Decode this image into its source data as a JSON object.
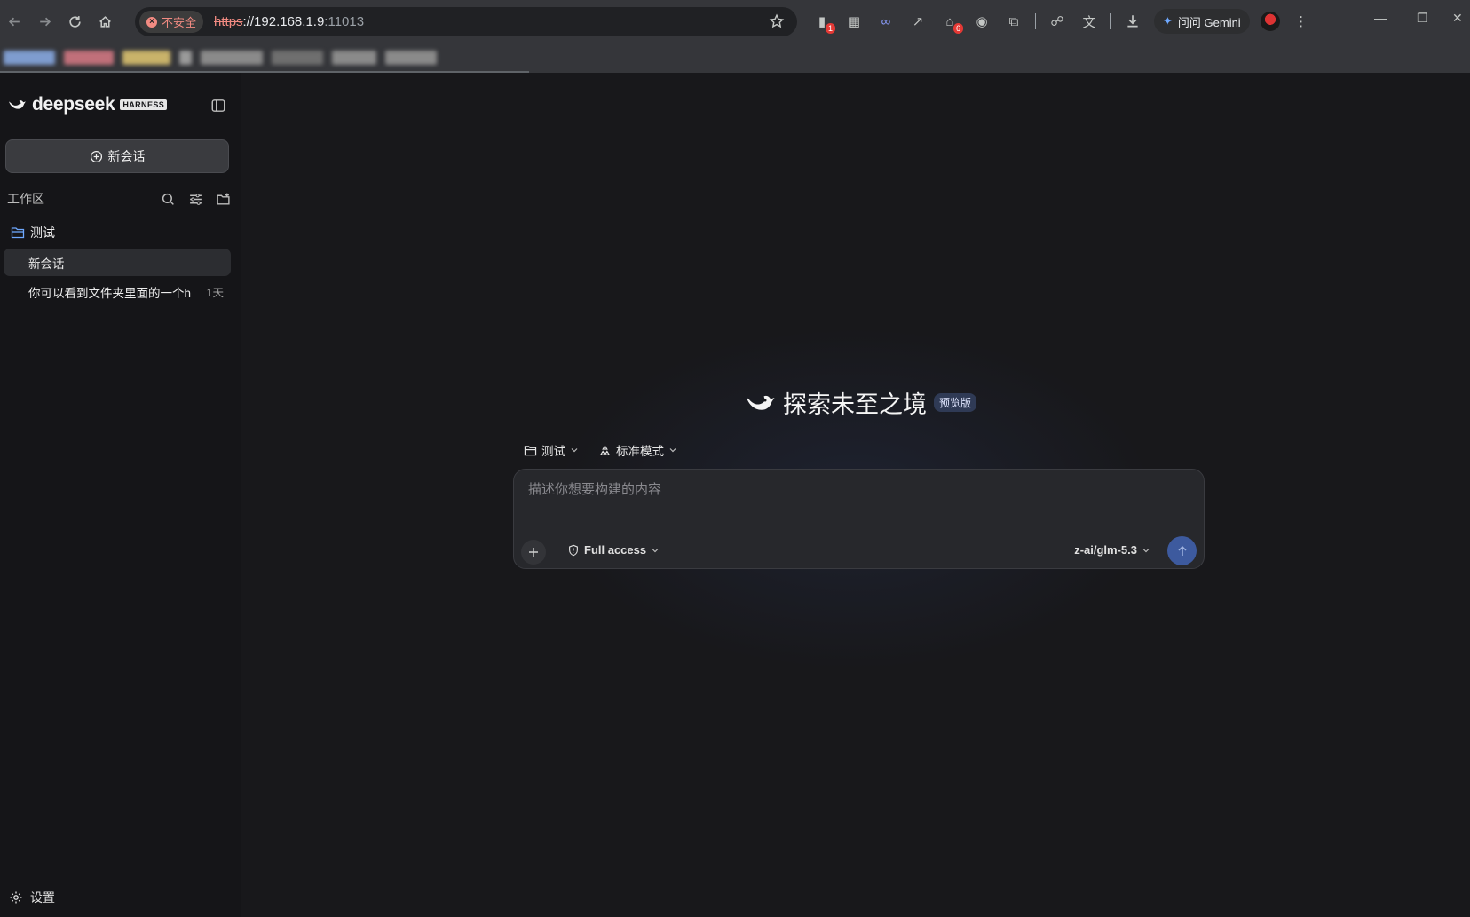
{
  "browser": {
    "insecure_label": "不安全",
    "url_scheme": "https",
    "url_host": "://192.168.1.9",
    "url_port": ":11013",
    "ext_badges": [
      "1",
      "6"
    ],
    "gemini_label": "问问 Gemini"
  },
  "sidebar": {
    "brand": "deepseek",
    "brand_tag": "HARNESS",
    "new_chat_label": "新会话",
    "workspace_label": "工作区",
    "folder_name": "测试",
    "conversations": [
      {
        "title": "新会话",
        "age": "",
        "active": true
      },
      {
        "title": "你可以看到文件夹里面的一个h",
        "age": "1天",
        "active": false
      }
    ],
    "settings_label": "设置"
  },
  "main": {
    "hero_title": "探索未至之境",
    "hero_badge": "预览版",
    "folder_selector": "测试",
    "mode_selector": "标准模式",
    "composer_placeholder": "描述你想要构建的内容",
    "access_label": "Full access",
    "model_label": "z-ai/glm-5.3"
  },
  "colors": {
    "accent": "#3d5a9e",
    "background": "#18181b",
    "sidebar": "#151518"
  }
}
